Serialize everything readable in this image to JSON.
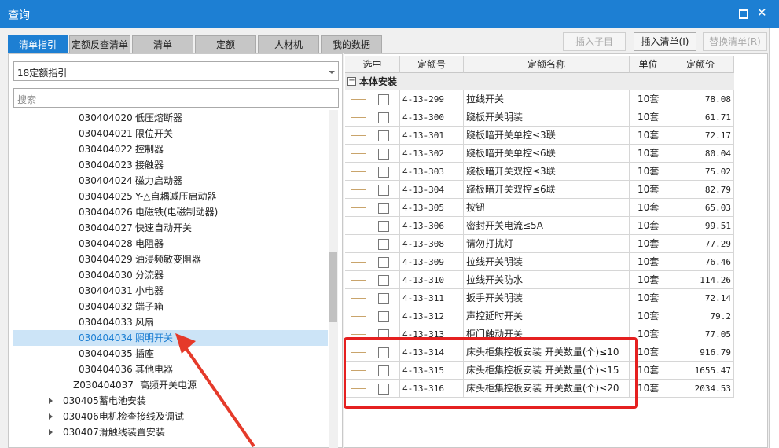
{
  "window": {
    "title": "查询",
    "maximize_icon": "square-maximize-icon",
    "close_icon": "close-x-icon"
  },
  "tabs": [
    {
      "label": "清单指引",
      "active": true
    },
    {
      "label": "定额反查清单",
      "active": false
    },
    {
      "label": "清单",
      "active": false
    },
    {
      "label": "定额",
      "active": false
    },
    {
      "label": "人材机",
      "active": false
    },
    {
      "label": "我的数据",
      "active": false
    }
  ],
  "toolbar": {
    "insert_child_label": "插入子目",
    "insert_list_label": "插入清单(I)",
    "replace_list_label": "替换清单(R)"
  },
  "left": {
    "combo_value": "18定额指引",
    "search_placeholder": "搜索",
    "tree": [
      {
        "code": "030404020",
        "name": "低压熔断器"
      },
      {
        "code": "030404021",
        "name": "限位开关"
      },
      {
        "code": "030404022",
        "name": "控制器"
      },
      {
        "code": "030404023",
        "name": "接触器"
      },
      {
        "code": "030404024",
        "name": "磁力启动器"
      },
      {
        "code": "030404025",
        "name": "Y-△自耦减压启动器"
      },
      {
        "code": "030404026",
        "name": "电磁铁(电磁制动器)"
      },
      {
        "code": "030404027",
        "name": "快速自动开关"
      },
      {
        "code": "030404028",
        "name": "电阻器"
      },
      {
        "code": "030404029",
        "name": "油浸频敏变阻器"
      },
      {
        "code": "030404030",
        "name": "分流器"
      },
      {
        "code": "030404031",
        "name": "小电器"
      },
      {
        "code": "030404032",
        "name": "端子箱"
      },
      {
        "code": "030404033",
        "name": "风扇"
      },
      {
        "code": "030404034",
        "name": "照明开关",
        "selected": true
      },
      {
        "code": "030404035",
        "name": "插座"
      },
      {
        "code": "030404036",
        "name": "其他电器"
      },
      {
        "code": "Z030404037",
        "name": "高频开关电源"
      },
      {
        "code": "030405",
        "name": "蓄电池安装",
        "parent": true
      },
      {
        "code": "030406",
        "name": "电机检查接线及调试",
        "parent": true
      },
      {
        "code": "030407",
        "name": "滑触线装置安装",
        "parent": true
      }
    ]
  },
  "grid": {
    "headers": {
      "select": "选中",
      "code": "定额号",
      "name": "定额名称",
      "unit": "单位",
      "price": "定额价"
    },
    "group": "本体安装",
    "rows": [
      {
        "code": "4-13-299",
        "name": "拉线开关",
        "unit": "10套",
        "price": "78.08"
      },
      {
        "code": "4-13-300",
        "name": "跷板开关明装",
        "unit": "10套",
        "price": "61.71"
      },
      {
        "code": "4-13-301",
        "name": "跷板暗开关单控≤3联",
        "unit": "10套",
        "price": "72.17"
      },
      {
        "code": "4-13-302",
        "name": "跷板暗开关单控≤6联",
        "unit": "10套",
        "price": "80.04"
      },
      {
        "code": "4-13-303",
        "name": "跷板暗开关双控≤3联",
        "unit": "10套",
        "price": "75.02"
      },
      {
        "code": "4-13-304",
        "name": "跷板暗开关双控≤6联",
        "unit": "10套",
        "price": "82.79"
      },
      {
        "code": "4-13-305",
        "name": "按钮",
        "unit": "10套",
        "price": "65.03"
      },
      {
        "code": "4-13-306",
        "name": "密封开关电流≤5A",
        "unit": "10套",
        "price": "99.51"
      },
      {
        "code": "4-13-308",
        "name": "请勿打扰灯",
        "unit": "10套",
        "price": "77.29"
      },
      {
        "code": "4-13-309",
        "name": "拉线开关明装",
        "unit": "10套",
        "price": "76.46"
      },
      {
        "code": "4-13-310",
        "name": "拉线开关防水",
        "unit": "10套",
        "price": "114.26"
      },
      {
        "code": "4-13-311",
        "name": "扳手开关明装",
        "unit": "10套",
        "price": "72.14"
      },
      {
        "code": "4-13-312",
        "name": "声控延时开关",
        "unit": "10套",
        "price": "79.2"
      },
      {
        "code": "4-13-313",
        "name": "柜门触动开关",
        "unit": "10套",
        "price": "77.05"
      },
      {
        "code": "4-13-314",
        "name": "床头柜集控板安装 开关数量(个)≤10",
        "unit": "10套",
        "price": "916.79"
      },
      {
        "code": "4-13-315",
        "name": "床头柜集控板安装 开关数量(个)≤15",
        "unit": "10套",
        "price": "1655.47"
      },
      {
        "code": "4-13-316",
        "name": "床头柜集控板安装 开关数量(个)≤20",
        "unit": "10套",
        "price": "2034.53"
      }
    ]
  },
  "colors": {
    "accent": "#1d7fd3",
    "highlight": "#e52020"
  }
}
